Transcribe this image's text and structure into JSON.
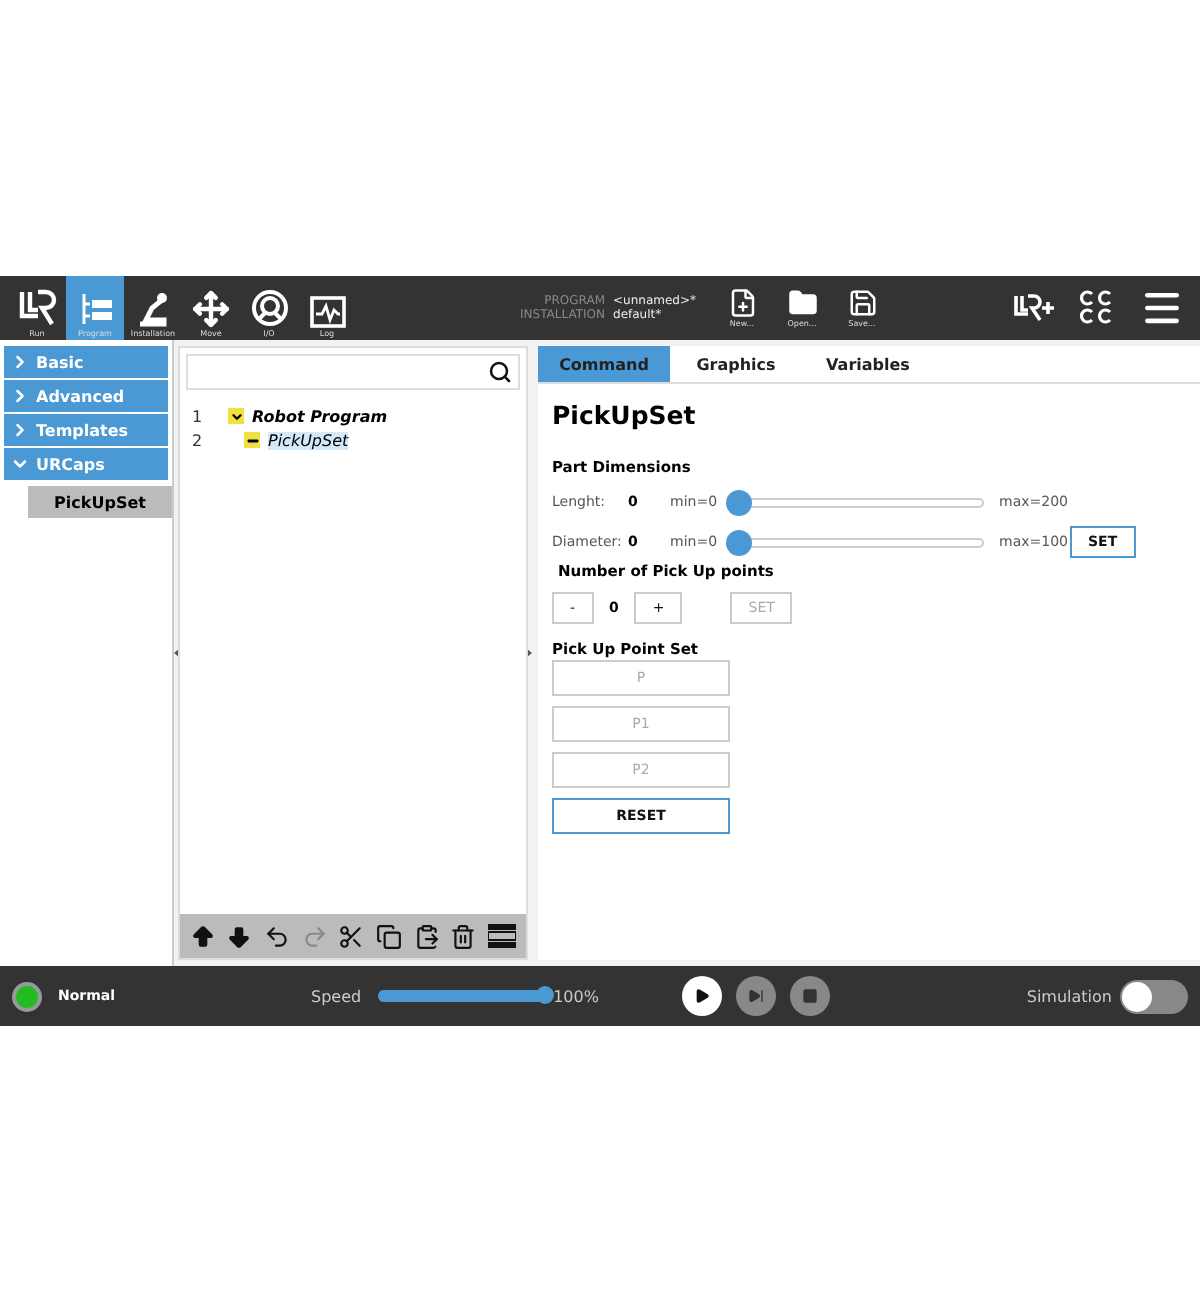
{
  "header": {
    "nav": [
      {
        "label": "Run",
        "kind": "logo",
        "selected": false
      },
      {
        "label": "Program",
        "kind": "program",
        "selected": true
      },
      {
        "label": "Installation",
        "kind": "installation",
        "selected": false
      },
      {
        "label": "Move",
        "kind": "move",
        "selected": false
      },
      {
        "label": "I/O",
        "kind": "io",
        "selected": false
      },
      {
        "label": "Log",
        "kind": "log",
        "selected": false
      }
    ],
    "info": [
      {
        "label": "PROGRAM",
        "value": "<unnamed>*"
      },
      {
        "label": "INSTALLATION",
        "value": "default*"
      }
    ],
    "files": [
      {
        "label": "New...",
        "kind": "new"
      },
      {
        "label": "Open...",
        "kind": "open"
      },
      {
        "label": "Save...",
        "kind": "save"
      }
    ]
  },
  "sidebar": {
    "items": [
      {
        "label": "Basic",
        "expanded": false
      },
      {
        "label": "Advanced",
        "expanded": false
      },
      {
        "label": "Templates",
        "expanded": false
      },
      {
        "label": "URCaps",
        "expanded": true,
        "children": [
          {
            "label": "PickUpSet",
            "selected": true
          }
        ]
      }
    ]
  },
  "tree": {
    "rows": [
      {
        "number": "1",
        "label": "Robot Program",
        "expanded": true,
        "selected": false,
        "children": [
          {
            "number": "2",
            "label": "PickUpSet",
            "expanded": false,
            "selected": true
          }
        ]
      }
    ],
    "toolbar": [
      {
        "kind": "up",
        "disabled": false
      },
      {
        "kind": "down",
        "disabled": false
      },
      {
        "kind": "undo",
        "disabled": false
      },
      {
        "kind": "redo",
        "disabled": true
      },
      {
        "kind": "cut",
        "disabled": false
      },
      {
        "kind": "copy",
        "disabled": false
      },
      {
        "kind": "paste",
        "disabled": false
      },
      {
        "kind": "delete",
        "disabled": false
      },
      {
        "kind": "suppress",
        "disabled": false
      }
    ]
  },
  "tabs": [
    {
      "label": "Command",
      "selected": true
    },
    {
      "label": "Graphics",
      "selected": false
    },
    {
      "label": "Variables",
      "selected": false
    }
  ],
  "command": {
    "title": "PickUpSet",
    "section": "Part Dimensions",
    "sliders": [
      {
        "label": "Lenght:",
        "value": "0",
        "min": "min=0",
        "max": "max=200",
        "level": 0
      },
      {
        "label": "Diameter:",
        "value": "0",
        "min": "min=0",
        "max": "max=100",
        "level": 0,
        "button": "SET"
      }
    ],
    "points_title": "Number of Pick Up points",
    "stepper": {
      "minus": "-",
      "value": "0",
      "plus": "+",
      "button": "SET",
      "disabled": true
    },
    "set_title": "Pick Up Point Set",
    "points": [
      {
        "label": "P",
        "disabled": true
      },
      {
        "label": "P1",
        "disabled": true
      },
      {
        "label": "P2",
        "disabled": true
      }
    ],
    "reset": "RESET"
  },
  "status": {
    "state": "Normal",
    "color": "#22bb22",
    "speed_label": "Speed",
    "level": 1,
    "speed": "100%",
    "simulation_label": "Simulation",
    "simulation": false
  }
}
